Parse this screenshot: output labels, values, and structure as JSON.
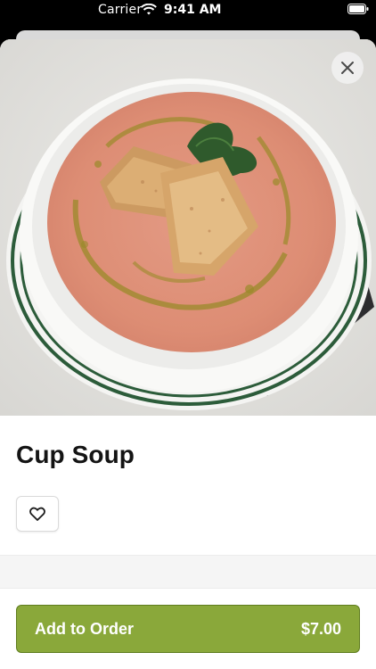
{
  "status_bar": {
    "carrier": "Carrier",
    "time": "9:41 AM",
    "icons": [
      "wifi-icon",
      "battery-icon"
    ]
  },
  "modal": {
    "close_icon": "close-icon",
    "image_alt_subject": "Bowl of tomato soup with croutons",
    "item": {
      "title": "Cup Soup",
      "favorite_icon": "heart-outline-icon"
    },
    "cta": {
      "label": "Add to Order",
      "price": "$7.00",
      "color": "#8aa83a"
    }
  }
}
